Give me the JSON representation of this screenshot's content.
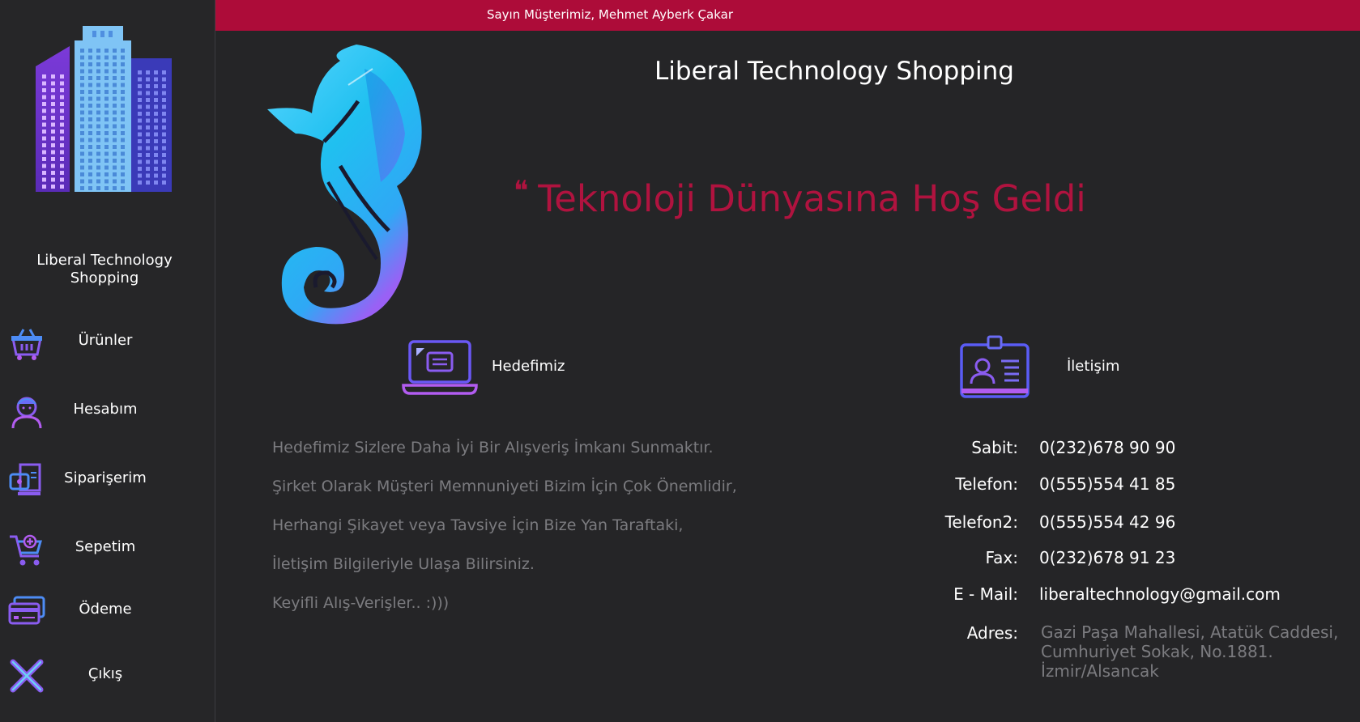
{
  "header": {
    "greeting": "Sayın Müşterimiz, Mehmet Ayberk Çakar"
  },
  "sidebar": {
    "brand_line1": "Liberal Technology",
    "brand_line2": "Shopping",
    "items": [
      {
        "label": "Ürünler",
        "icon": "basket-icon"
      },
      {
        "label": "Hesabım",
        "icon": "user-icon"
      },
      {
        "label": "Siparişerim",
        "icon": "receipt-icon"
      },
      {
        "label": "Sepetim",
        "icon": "cart-icon"
      },
      {
        "label": "Ödeme",
        "icon": "credit-card-icon"
      },
      {
        "label": "Çıkış",
        "icon": "close-icon"
      }
    ]
  },
  "main": {
    "title": "Liberal Technology Shopping",
    "welcome_quote": "❝",
    "welcome": "Teknoloji Dünyasına Hoş Geldi",
    "goal": {
      "title": "Hedefimiz",
      "icon": "laptop-icon",
      "lines": [
        "Hedefimiz Sizlere Daha İyi Bir Alışveriş İmkanı Sunmaktır.",
        "Şirket Olarak Müşteri Memnuniyeti Bizim İçin Çok Önemlidir,",
        "Herhangi Şikayet veya Tavsiye İçin Bize Yan Taraftaki,",
        "İletişim Bilgileriyle Ulaşa Bilirsiniz.",
        "Keyifli Alış-Verişler.. :)))"
      ]
    },
    "contact": {
      "title": "İletişim",
      "icon": "id-card-icon",
      "fields": [
        {
          "label": "Sabit:",
          "value": "0(232)678 90 90"
        },
        {
          "label": "Telefon:",
          "value": "0(555)554 41 85"
        },
        {
          "label": "Telefon2:",
          "value": "0(555)554 42 96"
        },
        {
          "label": "Fax:",
          "value": "0(232)678 91 23"
        },
        {
          "label": "E - Mail:",
          "value": "liberaltechnology@gmail.com"
        }
      ],
      "address_label": "Adres:",
      "address_lines": [
        "Gazi Paşa Mahallesi, Atatük Caddesi,",
        "Cumhuriyet Sokak, No.1881.",
        "İzmir/Alsancak"
      ]
    }
  },
  "colors": {
    "accent": "#ad0c39",
    "background": "#252527",
    "muted_text": "#7b7b7f"
  }
}
